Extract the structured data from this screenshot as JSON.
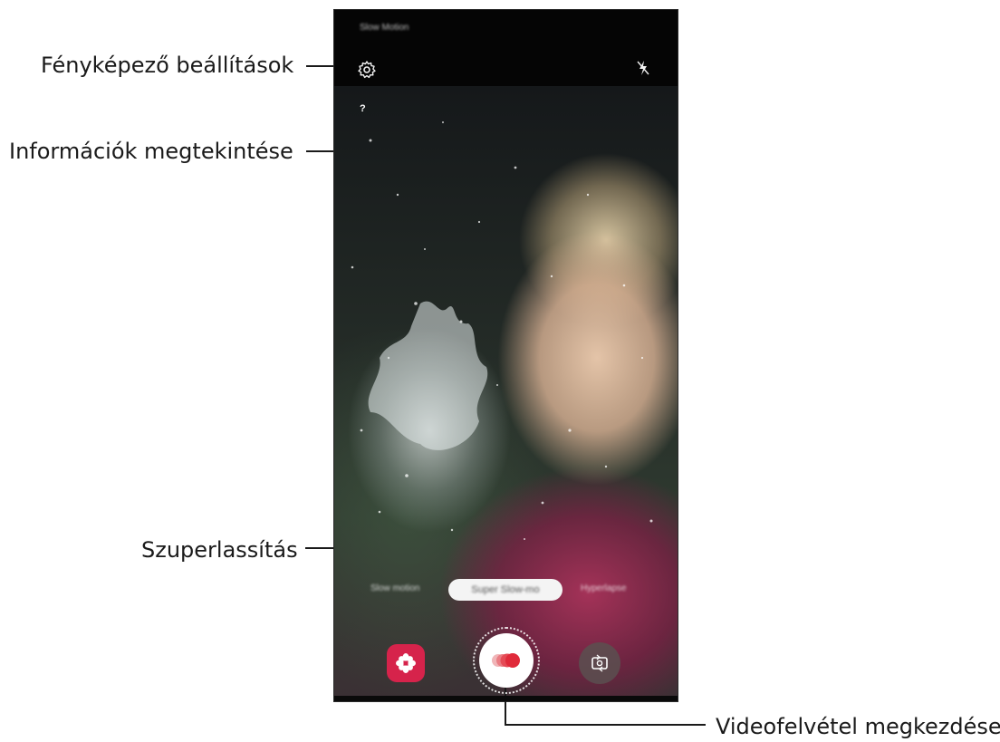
{
  "callouts": {
    "camera_settings": "Fényképező beállítások",
    "view_info": "Információk megtekintése",
    "super_slow_mo": "Szuperlassítás",
    "start_recording": "Videofelvétel megkezdése"
  },
  "screen": {
    "mode_title": "Slow Motion",
    "info_symbol": "?",
    "modes": [
      "Slow motion",
      "Super Slow-mo",
      "Hyperlapse"
    ],
    "selected_mode": "Super Slow-mo",
    "icons": {
      "settings": "gear-icon",
      "flash": "flash-off-icon",
      "info": "question-icon",
      "gallery": "flower-icon",
      "record": "super-slow-mo-record-icon",
      "switch_camera": "camera-switch-icon"
    },
    "colors": {
      "gallery_button": "#d6234b",
      "record_dots": "#e02a3a"
    }
  }
}
